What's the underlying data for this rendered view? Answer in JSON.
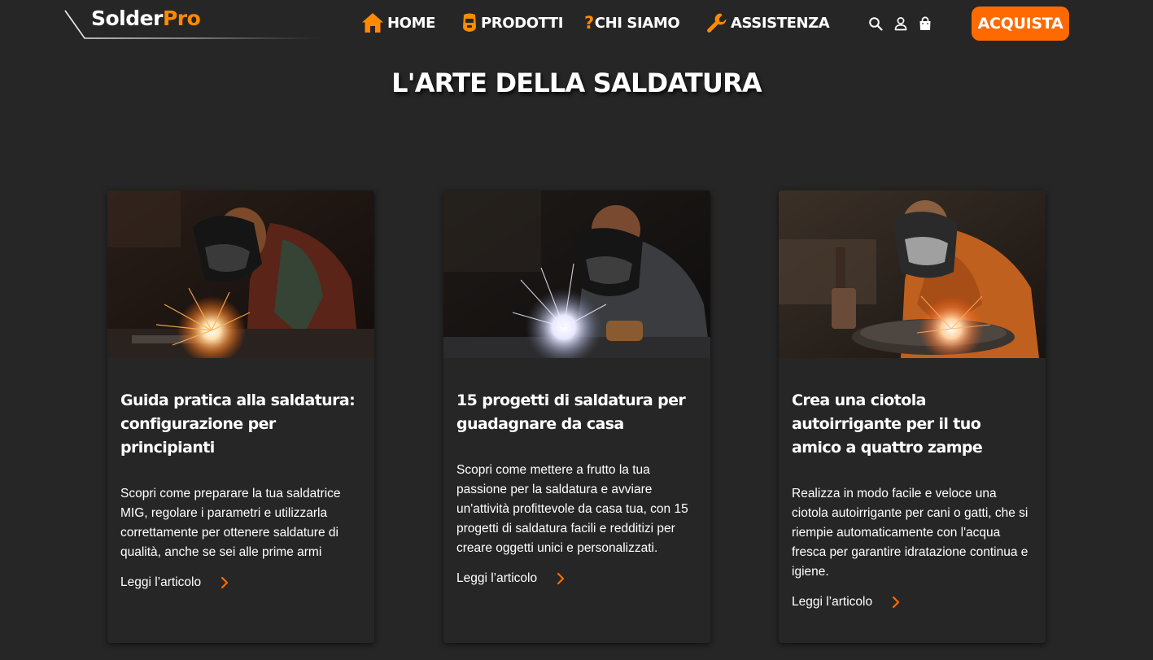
{
  "brand": {
    "name_part1": "Solder",
    "name_part2": "Pro",
    "accent_color": "#ff6a00",
    "logo_accent_color": "#ff8a00"
  },
  "nav": {
    "items": [
      {
        "label": "HOME",
        "icon": "home-icon"
      },
      {
        "label": "PRODOTTI",
        "icon": "welding-mask-icon"
      },
      {
        "label": "CHI SIAMO",
        "icon": "question-icon",
        "icon_glyph": "?"
      },
      {
        "label": "ASSISTENZA",
        "icon": "wrench-icon"
      }
    ],
    "header_icons": [
      "search-icon",
      "user-icon",
      "shopping-bag-icon"
    ],
    "cta_label": "ACQUISTA"
  },
  "page": {
    "title": "L'ARTE DELLA SALDATURA",
    "background": "#262626"
  },
  "articles": [
    {
      "title": "Guida pratica alla saldatura: configurazione per principianti",
      "description": "Scopri come preparare la tua saldatrice MIG, regolare i parametri e utilizzarla correttamente per ottenere saldature di qualità, anche se sei alle prime armi",
      "link_label": "Leggi l’articolo",
      "image": "welder-with-mask-and-sparks-photo"
    },
    {
      "title": "15 progetti di saldatura per guadagnare da casa",
      "description": "Scopri come mettere a frutto la tua passione per la saldatura e avviare un'attività profittevole da casa tua, con 15 progetti di saldatura facili e redditizi per creare oggetti unici e personalizzati.",
      "link_label": "Leggi l’articolo",
      "image": "welder-grey-jacket-sparks-photo"
    },
    {
      "title": "Crea una ciotola autoirrigante per il tuo amico a quattro zampe",
      "description": "Realizza in modo facile e veloce una ciotola autoirrigante per cani o gatti, che si riempie automaticamente con l'acqua fresca per garantire idratazione continua e igiene.",
      "link_label": "Leggi l’articolo",
      "image": "welder-orange-jacket-workshop-photo"
    }
  ]
}
